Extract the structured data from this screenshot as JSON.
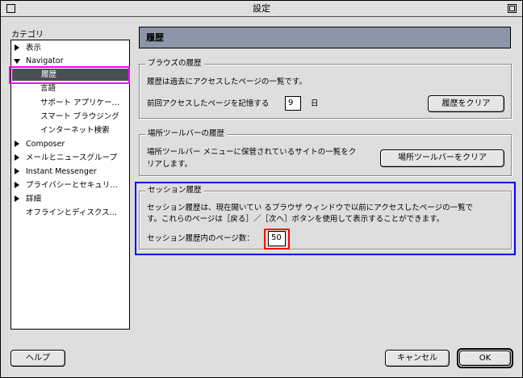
{
  "window": {
    "title": "設定"
  },
  "sidebar": {
    "label": "カテゴリ",
    "items": [
      {
        "label": "表示",
        "expander": "collapsed"
      },
      {
        "label": "Navigator",
        "expander": "expanded"
      },
      {
        "label": "履歴",
        "selected": true
      },
      {
        "label": "言語"
      },
      {
        "label": "サポート アプリケー…"
      },
      {
        "label": "スマート ブラウジング"
      },
      {
        "label": "インターネット検索"
      },
      {
        "label": "Composer",
        "expander": "collapsed"
      },
      {
        "label": "メールとニュースグループ",
        "expander": "collapsed"
      },
      {
        "label": "Instant Messenger",
        "expander": "collapsed"
      },
      {
        "label": "プライバシーとセキュリ…",
        "expander": "collapsed"
      },
      {
        "label": "詳細",
        "expander": "collapsed"
      },
      {
        "label": "オフラインとディスクス…"
      }
    ]
  },
  "main": {
    "header": "履歴",
    "browser_history": {
      "title": "ブラウズの履歴",
      "description": "履歴は過去にアクセスしたページの一覧です。",
      "days_label": "前回アクセスしたページを記憶する",
      "days_value": "9",
      "days_unit": "日",
      "clear_button": "履歴をクリア"
    },
    "location_bar_history": {
      "title": "場所ツールバーの履歴",
      "description_line1": "場所ツールバー メニューに保管されているサイトの一覧をク",
      "description_line2": "リアします。",
      "clear_button": "場所ツールバーをクリア"
    },
    "session_history": {
      "title": "セッション履歴",
      "description_line1": "セッション履歴は、現在開いてい るブラウザ ウィンドウで以前にアクセスしたページの一覧で",
      "description_line2": "す。これらのページは［戻る］／［次へ］ボタンを使用して表示することができます。",
      "pages_label": "セッション履歴内のページ数：",
      "pages_value": "50"
    }
  },
  "footer": {
    "help_button": "ヘルプ",
    "cancel_button": "キャンセル",
    "ok_button": "OK"
  }
}
